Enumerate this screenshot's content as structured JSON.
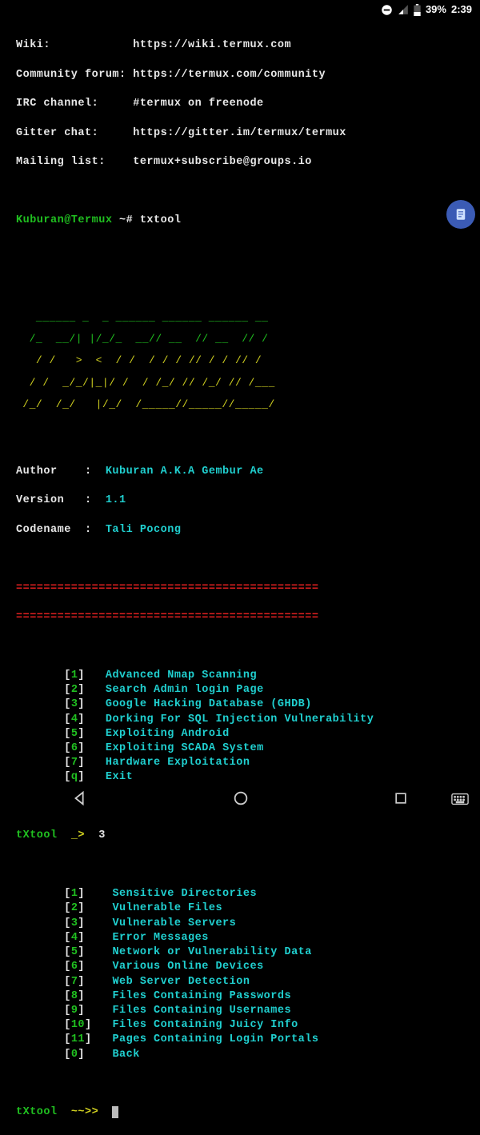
{
  "statusbar": {
    "battery": "39%",
    "time": "2:39"
  },
  "info": {
    "wiki_label": "Wiki:",
    "wiki_url": "https://wiki.termux.com",
    "forum_label": "Community forum:",
    "forum_url": "https://termux.com/community",
    "irc_label": "IRC channel:",
    "irc_val": "#termux on freenode",
    "gitter_label": "Gitter chat:",
    "gitter_url": "https://gitter.im/termux/termux",
    "mail_label": "Mailing list:",
    "mail_val": "termux+subscribe@groups.io"
  },
  "prompt": {
    "user": "Kuburan@Termux",
    "path": " ~# ",
    "cmd": "txtool"
  },
  "ascii": {
    "l1": "   ______ _  _ ______ ______ ______ __",
    "l2": "  /_  __/| |/_/_  __// __  // __  // /",
    "l3": "   / /   >  <  / /  / / / // / / // /",
    "l4": "  / /  _/_/|_|/ /  / /_/ // /_/ // /___",
    "l5": " /_/  /_/   |/_/  /_____//_____//_____/"
  },
  "meta": {
    "author_k": "Author",
    "author_v": "Kuburan A.K.A Gembur Ae",
    "version_k": "Version",
    "version_v": "1.1",
    "code_k": "Codename",
    "code_v": "Tali Pocong",
    "sep": " :  "
  },
  "divider": "============================================",
  "main_menu": [
    {
      "n": "1",
      "t": "Advanced Nmap Scanning"
    },
    {
      "n": "2",
      "t": "Search Admin login Page"
    },
    {
      "n": "3",
      "t": "Google Hacking Database (GHDB)"
    },
    {
      "n": "4",
      "t": "Dorking For SQL Injection Vulnerability"
    },
    {
      "n": "5",
      "t": "Exploiting Android"
    },
    {
      "n": "6",
      "t": "Exploiting SCADA System"
    },
    {
      "n": "7",
      "t": "Hardware Exploitation"
    },
    {
      "n": "q",
      "t": "Exit"
    }
  ],
  "input1": {
    "prompt": "tXtool",
    "sym": "_> ",
    "val": "3"
  },
  "sub_menu": [
    {
      "n": "1",
      "t": "Sensitive Directories"
    },
    {
      "n": "2",
      "t": "Vulnerable Files"
    },
    {
      "n": "3",
      "t": "Vulnerable Servers"
    },
    {
      "n": "4",
      "t": "Error Messages"
    },
    {
      "n": "5",
      "t": "Network or Vulnerability Data"
    },
    {
      "n": "6",
      "t": "Various Online Devices"
    },
    {
      "n": "7",
      "t": "Web Server Detection"
    },
    {
      "n": "8",
      "t": "Files Containing Passwords"
    },
    {
      "n": "9",
      "t": "Files Containing Usernames"
    },
    {
      "n": "10",
      "t": "Files Containing Juicy Info"
    },
    {
      "n": "11",
      "t": "Pages Containing Login Portals"
    },
    {
      "n": "0",
      "t": "Back"
    }
  ],
  "input2": {
    "prompt": "tXtool",
    "sym": "~~>> "
  }
}
